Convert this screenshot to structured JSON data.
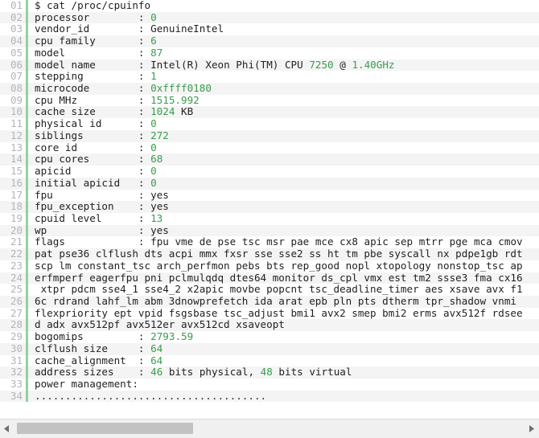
{
  "viewer": {
    "title": "cpuinfo-code-viewer",
    "accent_color": "#8fd49a",
    "value_color": "#3a9c4e",
    "text_color": "#1f1f1f",
    "gutter_color": "#b4b4b4",
    "alt_row_color": "#f4f4f4"
  },
  "lines": [
    {
      "num": "01",
      "key": "$ cat /proc/cpuinfo",
      "sep": "",
      "value": "",
      "value_color": "plain"
    },
    {
      "num": "02",
      "key": "processor",
      "sep": ":",
      "value": "0",
      "value_color": "num"
    },
    {
      "num": "03",
      "key": "vendor_id",
      "sep": ":",
      "value": "GenuineIntel",
      "value_color": "plain"
    },
    {
      "num": "04",
      "key": "cpu family",
      "sep": ":",
      "value": "6",
      "value_color": "num"
    },
    {
      "num": "05",
      "key": "model",
      "sep": ":",
      "value": "87",
      "value_color": "num"
    },
    {
      "num": "06",
      "key": "model name",
      "sep": ":",
      "value": "Intel(R) Xeon Phi(TM) CPU 7250 @ 1.40GHz",
      "value_color": "mixed"
    },
    {
      "num": "07",
      "key": "stepping",
      "sep": ":",
      "value": "1",
      "value_color": "num"
    },
    {
      "num": "08",
      "key": "microcode",
      "sep": ":",
      "value": "0xffff0180",
      "value_color": "num"
    },
    {
      "num": "09",
      "key": "cpu MHz",
      "sep": ":",
      "value": "1515.992",
      "value_color": "num"
    },
    {
      "num": "10",
      "key": "cache size",
      "sep": ":",
      "value": "1024 KB",
      "value_color": "mixed"
    },
    {
      "num": "11",
      "key": "physical id",
      "sep": ":",
      "value": "0",
      "value_color": "num"
    },
    {
      "num": "12",
      "key": "siblings",
      "sep": ":",
      "value": "272",
      "value_color": "num"
    },
    {
      "num": "13",
      "key": "core id",
      "sep": ":",
      "value": "0",
      "value_color": "num"
    },
    {
      "num": "14",
      "key": "cpu cores",
      "sep": ":",
      "value": "68",
      "value_color": "num"
    },
    {
      "num": "15",
      "key": "apicid",
      "sep": ":",
      "value": "0",
      "value_color": "num"
    },
    {
      "num": "16",
      "key": "initial apicid",
      "sep": ":",
      "value": "0",
      "value_color": "num"
    },
    {
      "num": "17",
      "key": "fpu",
      "sep": ":",
      "value": "yes",
      "value_color": "plain"
    },
    {
      "num": "18",
      "key": "fpu_exception",
      "sep": ":",
      "value": "yes",
      "value_color": "plain"
    },
    {
      "num": "19",
      "key": "cpuid level",
      "sep": ":",
      "value": "13",
      "value_color": "num"
    },
    {
      "num": "20",
      "key": "wp",
      "sep": ":",
      "value": "yes",
      "value_color": "plain"
    },
    {
      "num": "21",
      "key": "flags",
      "sep": ":",
      "value": "fpu vme de pse tsc msr pae mce cx8 apic sep mtrr pge mca cmov",
      "value_color": "plain"
    },
    {
      "num": "22",
      "key": "",
      "sep": "",
      "value": "pat pse36 clflush dts acpi mmx fxsr sse sse2 ss ht tm pbe syscall nx pdpe1gb rdt",
      "value_color": "plain",
      "raw": true
    },
    {
      "num": "23",
      "key": "",
      "sep": "",
      "value": "scp lm constant_tsc arch_perfmon pebs bts rep_good nopl xtopology nonstop_tsc ap",
      "value_color": "plain",
      "raw": true
    },
    {
      "num": "24",
      "key": "",
      "sep": "",
      "value": "erfmperf eagerfpu pni pclmulqdq dtes64 monitor ds_cpl vmx est tm2 ssse3 fma cx16",
      "value_color": "plain",
      "raw": true
    },
    {
      "num": "25",
      "key": "",
      "sep": "",
      "value": " xtpr pdcm sse4_1 sse4_2 x2apic movbe popcnt tsc_deadline_timer aes xsave avx f1",
      "value_color": "plain",
      "raw": true
    },
    {
      "num": "26",
      "key": "",
      "sep": "",
      "value": "6c rdrand lahf_lm abm 3dnowprefetch ida arat epb pln pts dtherm tpr_shadow vnmi",
      "value_color": "plain",
      "raw": true
    },
    {
      "num": "27",
      "key": "",
      "sep": "",
      "value": "flexpriority ept vpid fsgsbase tsc_adjust bmi1 avx2 smep bmi2 erms avx512f rdsee",
      "value_color": "plain",
      "raw": true
    },
    {
      "num": "28",
      "key": "",
      "sep": "",
      "value": "d adx avx512pf avx512er avx512cd xsaveopt",
      "value_color": "plain",
      "raw": true
    },
    {
      "num": "29",
      "key": "bogomips",
      "sep": ":",
      "value": "2793.59",
      "value_color": "num"
    },
    {
      "num": "30",
      "key": "clflush size",
      "sep": ":",
      "value": "64",
      "value_color": "num"
    },
    {
      "num": "31",
      "key": "cache_alignment",
      "sep": ":",
      "value": "64",
      "value_color": "num"
    },
    {
      "num": "32",
      "key": "address sizes",
      "sep": ":",
      "value": "46 bits physical, 48 bits virtual",
      "value_color": "mixed"
    },
    {
      "num": "33",
      "key": "power management:",
      "sep": "",
      "value": "",
      "value_color": "plain"
    },
    {
      "num": "34",
      "key": "",
      "sep": "",
      "value": "......................................",
      "value_color": "rule",
      "raw": true
    }
  ],
  "scrollbar": {
    "left_arrow": "scroll-left",
    "right_arrow": "scroll-right",
    "thumb_label": "horizontal-scroll-thumb"
  }
}
